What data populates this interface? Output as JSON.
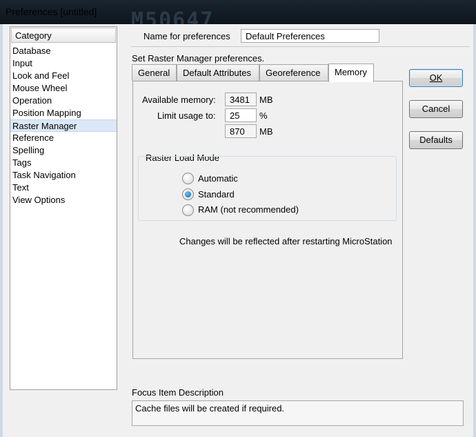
{
  "window": {
    "title": "Preferences [untitled]"
  },
  "background_text": "M50647",
  "category": {
    "header": "Category",
    "items": [
      "Database",
      "Input",
      "Look and Feel",
      "Mouse Wheel",
      "Operation",
      "Position Mapping",
      "Raster Manager",
      "Reference",
      "Spelling",
      "Tags",
      "Task Navigation",
      "Text",
      "View Options"
    ],
    "selected": "Raster Manager"
  },
  "name_for_preferences": {
    "label": "Name for preferences",
    "value": "Default Preferences"
  },
  "section_title": "Set Raster Manager preferences.",
  "tabs": [
    {
      "label": "General"
    },
    {
      "label": "Default Attributes"
    },
    {
      "label": "Georeference"
    },
    {
      "label": "Memory"
    }
  ],
  "active_tab": "Memory",
  "memory": {
    "available_label": "Available memory:",
    "available_value": "3481",
    "available_unit": "MB",
    "limit_label": "Limit usage to:",
    "limit_value": "25",
    "limit_unit": "%",
    "limit_mb_value": "870",
    "limit_mb_unit": "MB"
  },
  "raster_load_mode": {
    "title": "Raster Load Mode",
    "options": [
      "Automatic",
      "Standard",
      "RAM (not recommended)"
    ],
    "selected": "Standard"
  },
  "restart_note": "Changes will be reflected after restarting MicroStation",
  "buttons": {
    "ok": "OK",
    "cancel": "Cancel",
    "defaults": "Defaults"
  },
  "focus": {
    "label": "Focus Item Description",
    "text": "Cache files will be created if required."
  }
}
